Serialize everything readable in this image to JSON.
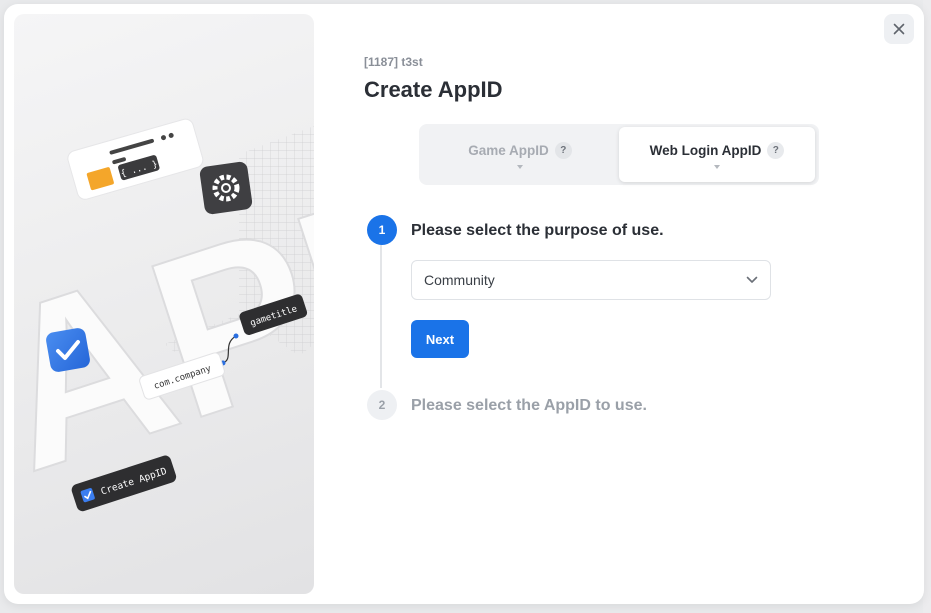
{
  "dialog": {
    "project": "[1187] t3st",
    "title": "Create AppID",
    "close_icon": "close-icon"
  },
  "tabs": [
    {
      "label": "Game AppID",
      "help": "?",
      "active": false
    },
    {
      "label": "Web Login AppID",
      "help": "?",
      "active": true
    }
  ],
  "steps": [
    {
      "number": "1",
      "title": "Please select the purpose of use.",
      "state": "active"
    },
    {
      "number": "2",
      "title": "Please select the AppID to use.",
      "state": "pending"
    }
  ],
  "purpose_select": {
    "value": "Community"
  },
  "next_button": {
    "label": "Next"
  },
  "illustration": {
    "big_text": "API",
    "code_card": "{ ... }",
    "chip_company": "com.company",
    "chip_gametitle": "gametitle",
    "chip_create": "Create AppID",
    "icons": [
      "folder-icon",
      "gear-icon",
      "checkbox-icon"
    ]
  },
  "colors": {
    "primary": "#1a73e8",
    "title": "#2b2f36",
    "muted": "#9aa0a8",
    "tab_bg": "#f1f2f4"
  }
}
